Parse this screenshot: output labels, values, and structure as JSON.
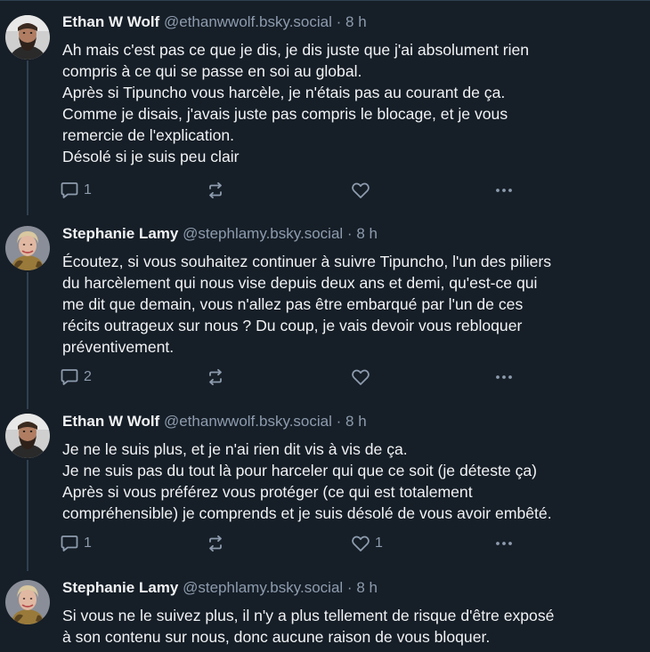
{
  "posts": [
    {
      "author": "Ethan W Wolf",
      "handle": "@ethanwwolf.bsky.social",
      "separator": "·",
      "time": "8 h",
      "avatar": "bearded-man-avatar",
      "lines": [
        "Ah mais c'est pas ce que je dis, je dis juste que j'ai absolument rien",
        "compris à ce qui se passe en soi au global.",
        "Après si Tipuncho vous harcèle, je n'étais pas au courant de ça.",
        "Comme je disais, j'avais juste pas compris le blocage, et je vous",
        "remercie de l'explication.",
        "Désolé si je suis peu clair"
      ],
      "reply_count": "1",
      "repost_count": "",
      "like_count": ""
    },
    {
      "author": "Stephanie Lamy",
      "handle": "@stephlamy.bsky.social",
      "separator": "·",
      "time": "8 h",
      "avatar": "woman-avatar",
      "lines": [
        "Écoutez, si vous souhaitez continuer à suivre Tipuncho, l'un des piliers",
        "du harcèlement qui nous vise depuis deux ans et demi, qu'est-ce qui",
        "me dit que demain, vous n'allez pas être embarqué par l'un de ces",
        "récits outrageux sur nous ? Du coup, je vais devoir vous rebloquer",
        "préventivement."
      ],
      "reply_count": "2",
      "repost_count": "",
      "like_count": ""
    },
    {
      "author": "Ethan W Wolf",
      "handle": "@ethanwwolf.bsky.social",
      "separator": "·",
      "time": "8 h",
      "avatar": "bearded-man-avatar",
      "lines": [
        "Je ne le suis plus, et je n'ai rien dit vis à vis de ça.",
        "Je ne suis pas du tout là pour harceler qui que ce soit (je déteste ça)",
        "Après si vous préférez vous protéger (ce qui est totalement",
        "compréhensible) je comprends et je suis désolé de vous avoir embêté."
      ],
      "reply_count": "1",
      "repost_count": "",
      "like_count": "1"
    },
    {
      "author": "Stephanie Lamy",
      "handle": "@stephlamy.bsky.social",
      "separator": "·",
      "time": "8 h",
      "avatar": "woman-avatar",
      "lines": [
        "Si vous ne le suivez plus, il n'y a plus tellement de risque d'être exposé",
        "à son contenu sur nous, donc aucune raison de vous bloquer."
      ],
      "reply_count": "",
      "repost_count": "",
      "like_count": ""
    }
  ],
  "icons": {
    "reply": "reply-icon",
    "repost": "repost-icon",
    "like": "heart-icon",
    "more": "more-options-icon"
  },
  "colors": {
    "background": "#161e27",
    "text": "#f1f3f5",
    "muted": "#8d9cae",
    "thread_line": "#2e4052"
  }
}
